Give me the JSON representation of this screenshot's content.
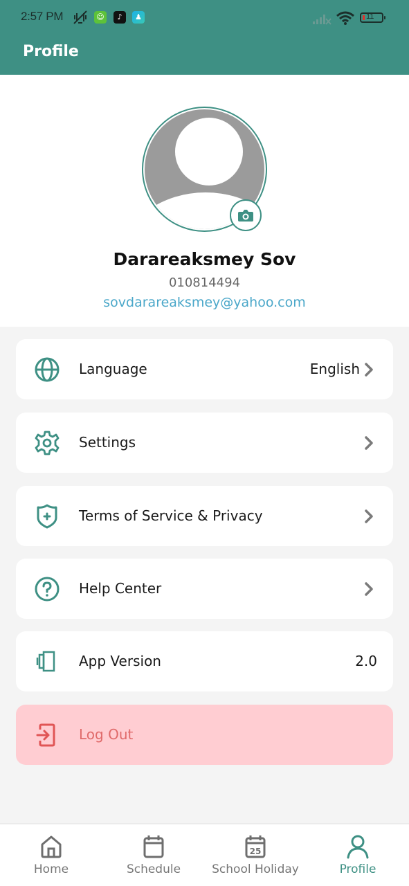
{
  "status_bar": {
    "time": "2:57 PM",
    "battery_level": "11",
    "icons": [
      "vibrate-off-icon",
      "app-notification-icon",
      "tiktok-icon",
      "app-notification-icon",
      "signal-icon",
      "wifi-icon",
      "battery-icon"
    ]
  },
  "header": {
    "title": "Profile"
  },
  "profile": {
    "name": "Darareaksmey Sov",
    "phone": "010814494",
    "email": "sovdarareaksmey@yahoo.com",
    "avatar_icon": "default-avatar-icon",
    "change_photo_icon": "camera-icon"
  },
  "menu": [
    {
      "label": "Language",
      "value": "English",
      "icon": "globe-icon",
      "arrow": true
    },
    {
      "label": "Settings",
      "value": "",
      "icon": "gear-icon",
      "arrow": true
    },
    {
      "label": "Terms of Service & Privacy",
      "value": "",
      "icon": "shield-plus-icon",
      "arrow": true
    },
    {
      "label": "Help Center",
      "value": "",
      "icon": "help-circle-icon",
      "arrow": true
    },
    {
      "label": "App Version",
      "value": "2.0",
      "icon": "app-version-icon",
      "arrow": false
    },
    {
      "label": "Log Out",
      "value": "",
      "icon": "logout-icon",
      "arrow": false
    }
  ],
  "bottom_nav": [
    {
      "label": "Home",
      "icon": "home-icon",
      "active": false
    },
    {
      "label": "Schedule",
      "icon": "calendar-icon",
      "active": false
    },
    {
      "label": "School Holiday",
      "icon": "calendar-25-icon",
      "active": false,
      "icon_text": "25"
    },
    {
      "label": "Profile",
      "icon": "user-icon",
      "active": true
    }
  ],
  "colors": {
    "primary": "#3e9084",
    "logout_bg": "#ffcdd2",
    "logout_text": "#e06a6a",
    "email": "#4aa7c9"
  }
}
